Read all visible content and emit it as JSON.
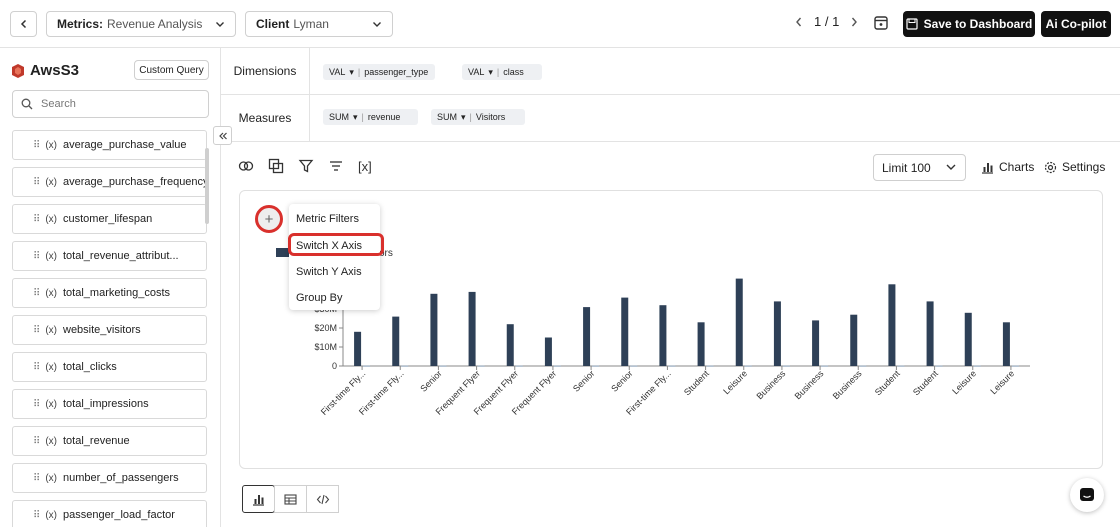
{
  "header": {
    "metrics_label": "Metrics:",
    "metrics_value": "Revenue Analysis",
    "client_label": "Client",
    "client_value": "Lyman",
    "pager": "1 / 1",
    "save_label": "Save to Dashboard",
    "ai_label": "Ai Co-pilot"
  },
  "sidebar": {
    "source_name": "AwsS3",
    "custom_query_label": "Custom Query",
    "search_placeholder": "Search",
    "fields": [
      "average_purchase_value",
      "average_purchase_frequency...",
      "customer_lifespan",
      "total_revenue_attribut...",
      "total_marketing_costs",
      "website_visitors",
      "total_clicks",
      "total_impressions",
      "total_revenue",
      "number_of_passengers",
      "passenger_load_factor"
    ]
  },
  "dimensions": {
    "label": "Dimensions",
    "chips": [
      {
        "agg": "VAL",
        "name": "passenger_type"
      },
      {
        "agg": "VAL",
        "name": "class"
      }
    ]
  },
  "measures": {
    "label": "Measures",
    "chips": [
      {
        "agg": "SUM",
        "name": "revenue"
      },
      {
        "agg": "SUM",
        "name": "Visitors"
      }
    ]
  },
  "toolbar": {
    "limit_label": "Limit",
    "limit_value": "100",
    "charts_label": "Charts",
    "settings_label": "Settings",
    "var_glyph": "[x]"
  },
  "popup_menu": {
    "items": [
      "Metric Filters",
      "Switch X Axis",
      "Switch Y Axis",
      "Group By"
    ],
    "highlighted": "Switch X Axis"
  },
  "legend_partial": "ors",
  "colors": {
    "bar": "#2e4057",
    "accent_red": "#d9302c",
    "button_dark": "#111111"
  },
  "chart_data": {
    "type": "bar",
    "categories": [
      "First-time Fly...",
      "First-time Fly...",
      "Senior",
      "Frequent Flyer",
      "Frequent Flyer",
      "Frequent Flyer",
      "Senior",
      "Senior",
      "First-time Fly...",
      "Student",
      "Leisure",
      "Business",
      "Business",
      "Business",
      "Student",
      "Student",
      "Leisure",
      "Leisure"
    ],
    "series": [
      {
        "name": "revenue",
        "values": [
          18,
          26,
          38,
          39,
          22,
          15,
          31,
          36,
          32,
          23,
          46,
          34,
          24,
          27,
          43,
          34,
          28,
          23
        ]
      },
      {
        "name": "Visitors",
        "values": [
          0.2,
          0.2,
          0.2,
          0.2,
          0.2,
          0.2,
          0.2,
          0.2,
          0.2,
          0.2,
          0.2,
          0.2,
          0.2,
          0.2,
          0.2,
          0.2,
          0.2,
          0.2
        ]
      }
    ],
    "y_ticks": [
      "0",
      "$10M",
      "$20M",
      "$30M"
    ],
    "ylim": [
      0,
      50
    ],
    "unit": "M"
  }
}
